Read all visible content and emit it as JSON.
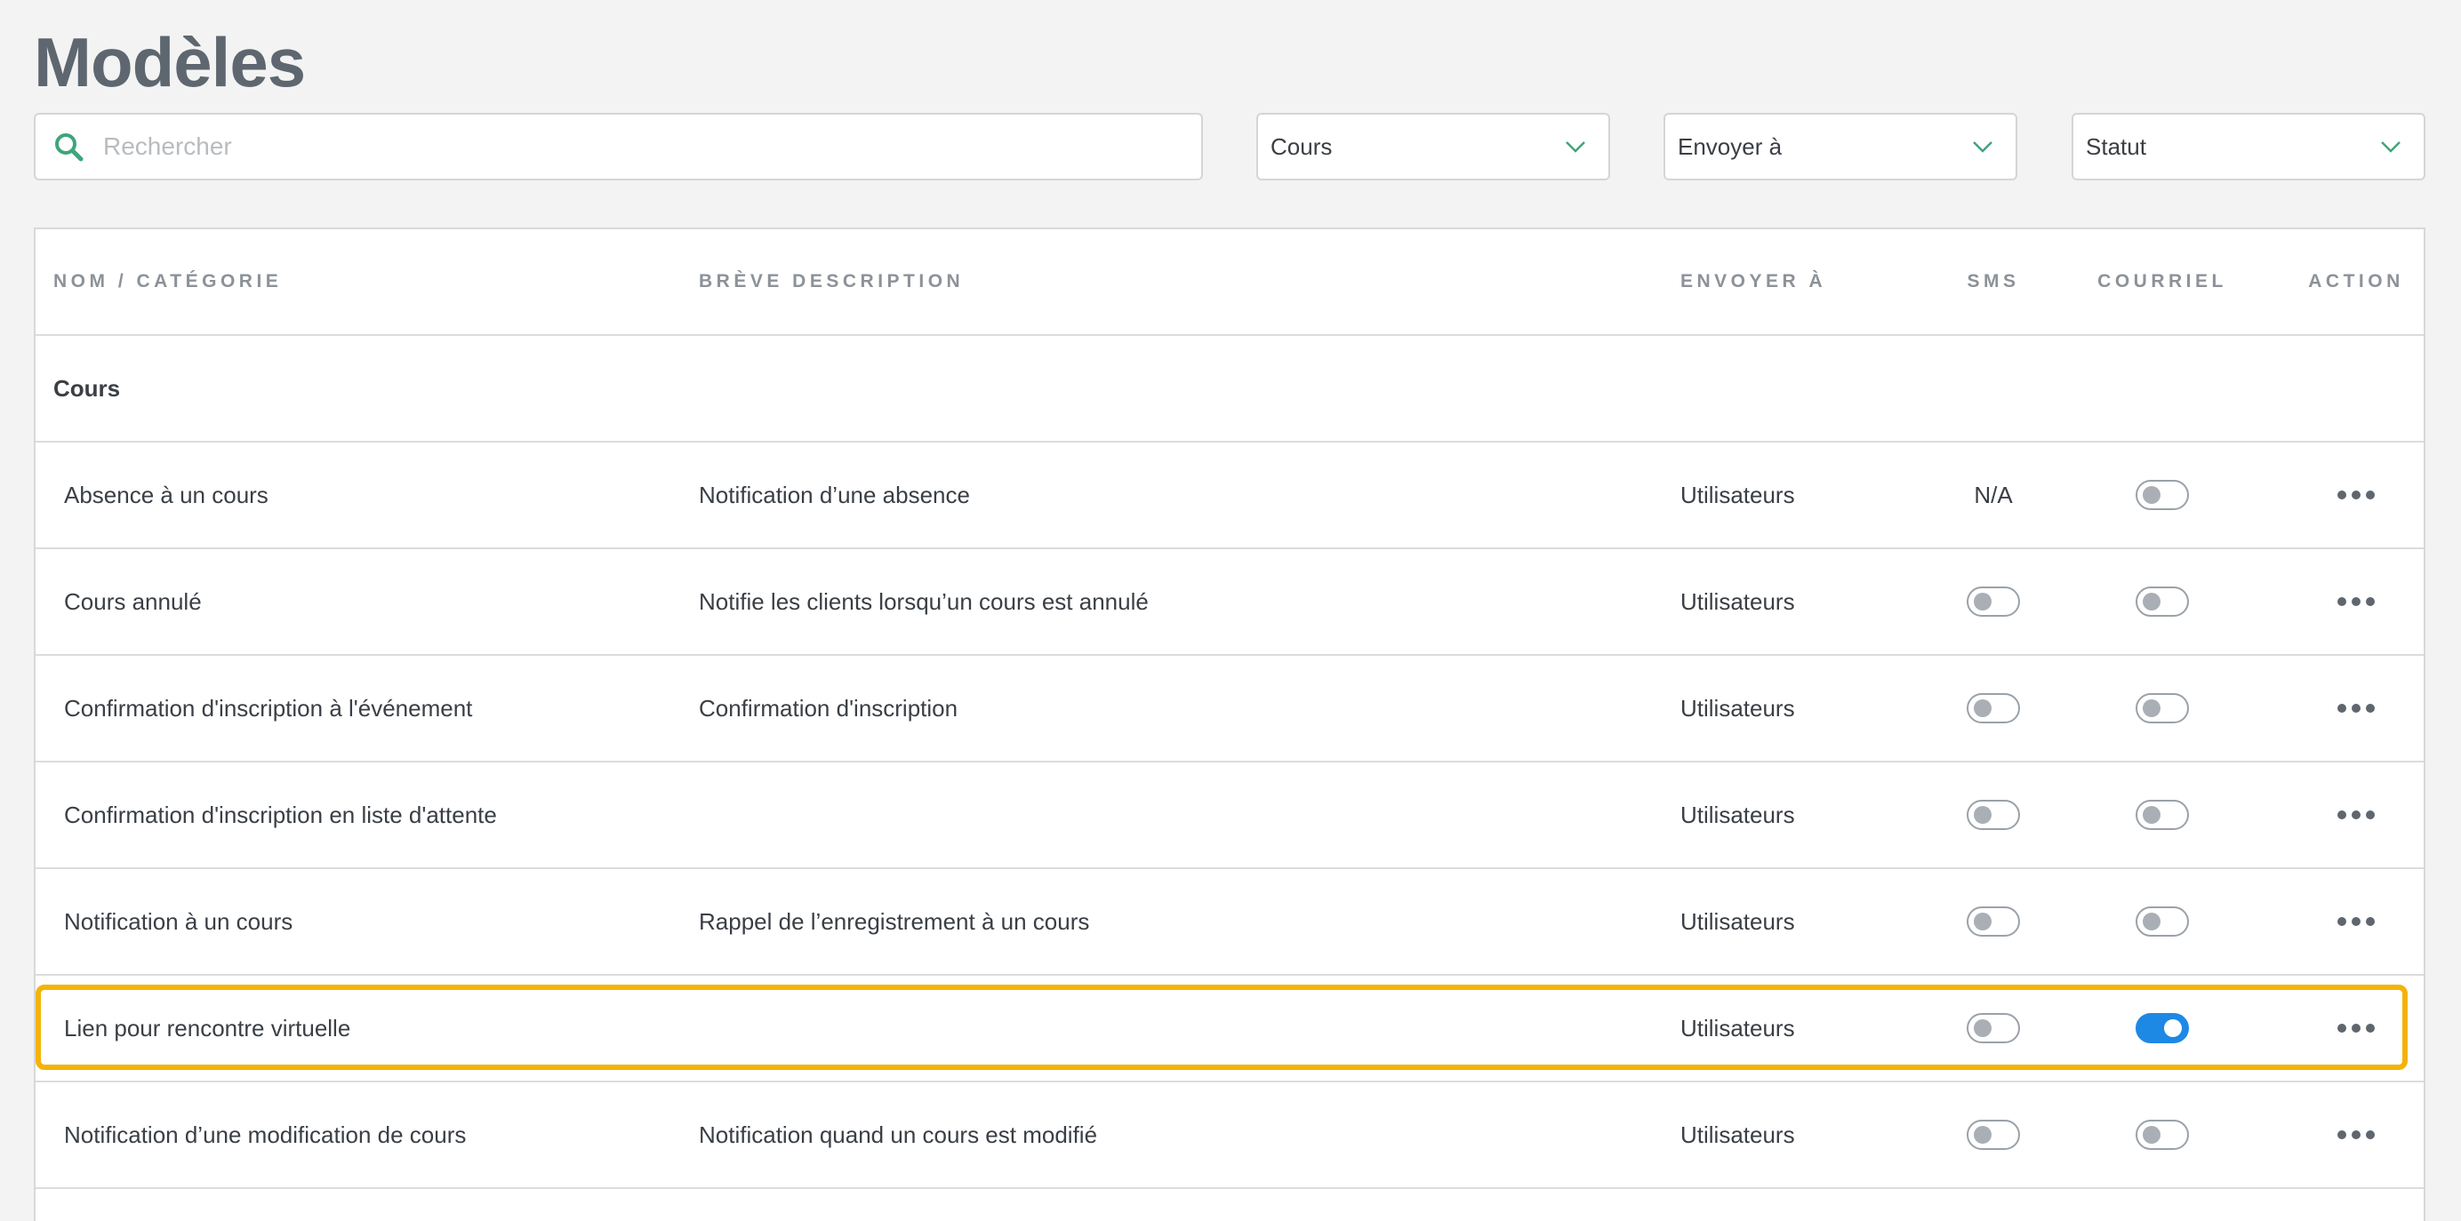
{
  "page": {
    "title": "Modèles"
  },
  "search": {
    "placeholder": "Rechercher",
    "value": ""
  },
  "filters": {
    "category": "Cours",
    "send_to": "Envoyer à",
    "status": "Statut"
  },
  "table": {
    "headers": {
      "name": "NOM / CATÉGORIE",
      "desc": "BRÈVE DESCRIPTION",
      "send": "ENVOYER À",
      "sms": "SMS",
      "mail": "COURRIEL",
      "action": "ACTION"
    },
    "category_label": "Cours",
    "rows": [
      {
        "name": "Absence à un cours",
        "desc": "Notification d’une absence",
        "send": "Utilisateurs",
        "sms_text": "N/A",
        "sms": null,
        "mail": false
      },
      {
        "name": "Cours annulé",
        "desc": "Notifie les clients lorsqu’un cours est annulé",
        "send": "Utilisateurs",
        "sms_text": null,
        "sms": false,
        "mail": false
      },
      {
        "name": "Confirmation d'inscription à l'événement",
        "desc": "Confirmation d'inscription",
        "send": "Utilisateurs",
        "sms_text": null,
        "sms": false,
        "mail": false
      },
      {
        "name": "Confirmation d'inscription en liste d'attente",
        "desc": "",
        "send": "Utilisateurs",
        "sms_text": null,
        "sms": false,
        "mail": false
      },
      {
        "name": "Notification à un cours",
        "desc": "Rappel de l’enregistrement à un cours",
        "send": "Utilisateurs",
        "sms_text": null,
        "sms": false,
        "mail": false
      },
      {
        "name": "Lien pour rencontre virtuelle",
        "desc": "",
        "send": "Utilisateurs",
        "sms_text": null,
        "sms": false,
        "mail": true
      },
      {
        "name": "Notification d’une modification de cours",
        "desc": "Notification quand un cours est modifié",
        "send": "Utilisateurs",
        "sms_text": null,
        "sms": false,
        "mail": false
      }
    ]
  },
  "colors": {
    "accent_search_icon": "#3fa57a",
    "toggle_on": "#1e88e5",
    "highlight": "#f4b30a"
  }
}
